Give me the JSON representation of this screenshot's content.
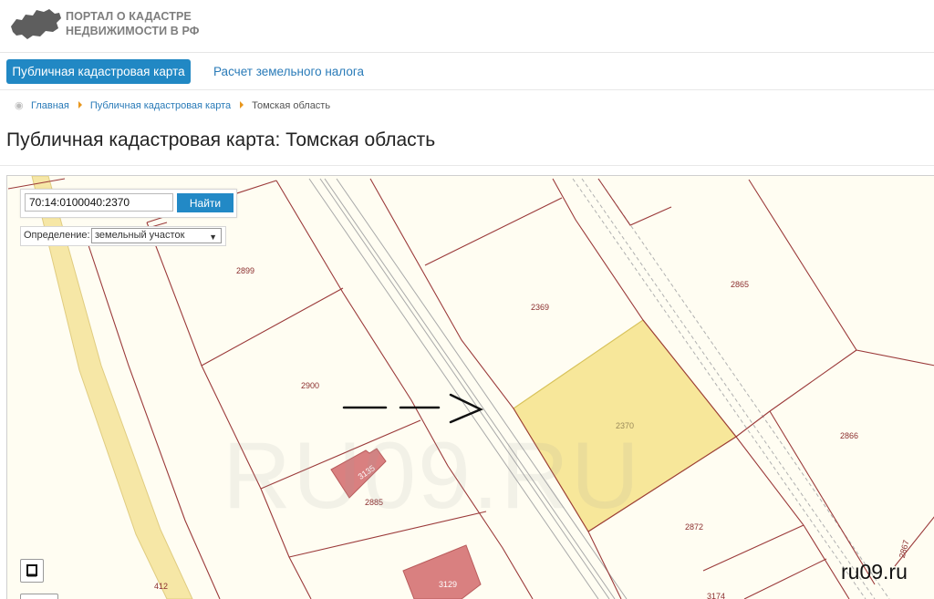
{
  "header": {
    "logo_line1": "ПОРТАЛ О КАДАСТРЕ",
    "logo_line2": "НЕДВИЖИМОСТИ В РФ",
    "logo_icon": "russia-map-icon"
  },
  "nav": {
    "tabs": [
      {
        "label": "Публичная кадастровая карта",
        "active": true
      },
      {
        "label": "Расчет земельного налога",
        "active": false
      }
    ]
  },
  "breadcrumb": {
    "icon": "map-pin-icon",
    "items": [
      "Главная",
      "Публичная кадастровая карта",
      "Томская область"
    ]
  },
  "page": {
    "title": "Публичная кадастровая карта: Томская область"
  },
  "map": {
    "search_value": "70:14:0100040:2370",
    "search_button": "Найти",
    "definition_label": "Определение:",
    "definition_selected": "земельный участок",
    "watermark": "RU09.RU",
    "site_mark": "ru09.ru",
    "colors": {
      "parcel_border": "#9b3a3a",
      "parcel_selected": "#f7e79a",
      "building": "#d98080",
      "road": "#f6e7a6"
    },
    "parcels": [
      "2899",
      "2900",
      "2885",
      "2369",
      "2370",
      "2865",
      "2866",
      "2872",
      "2867",
      "3174",
      "412"
    ],
    "buildings": [
      "3135",
      "3129"
    ]
  }
}
